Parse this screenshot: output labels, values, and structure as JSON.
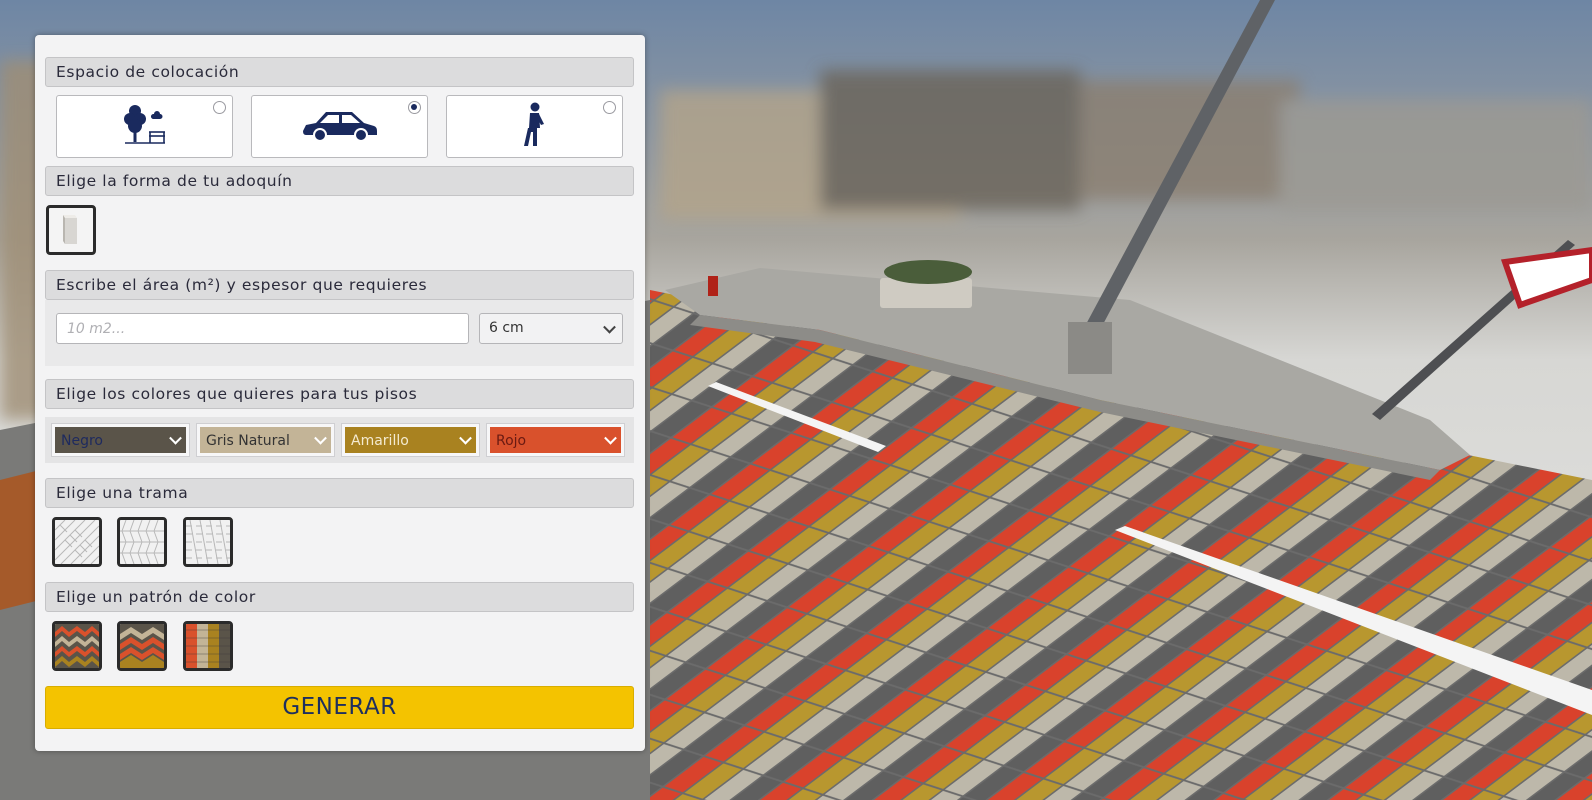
{
  "sections": {
    "placement": "Espacio de colocación",
    "shape": "Elige la forma de tu adoquín",
    "area": "Escribe el área (m²) y espesor que requieres",
    "colors": "Elige los colores que quieres para tus pisos",
    "trama": "Elige una trama",
    "pattern": "Elige un patrón de color"
  },
  "placement_options": [
    {
      "icon": "park-icon",
      "selected": false
    },
    {
      "icon": "car-icon",
      "selected": true
    },
    {
      "icon": "pedestrian-icon",
      "selected": false
    }
  ],
  "area": {
    "placeholder": "10 m2...",
    "value": "",
    "thickness": "6 cm"
  },
  "color_selects": [
    {
      "label": "Negro",
      "bg": "#5a5449",
      "text": "#1e2a5e"
    },
    {
      "label": "Gris Natural",
      "bg": "#c3b497",
      "text": "#333333"
    },
    {
      "label": "Amarillo",
      "bg": "#a98220",
      "text": "#f4ead0"
    },
    {
      "label": "Rojo",
      "bg": "#d9512c",
      "text": "#6a1a12"
    }
  ],
  "button": {
    "generate": "GENERAR"
  },
  "colors": {
    "accent": "#f4c300",
    "brand_navy": "#1a2a5e"
  }
}
